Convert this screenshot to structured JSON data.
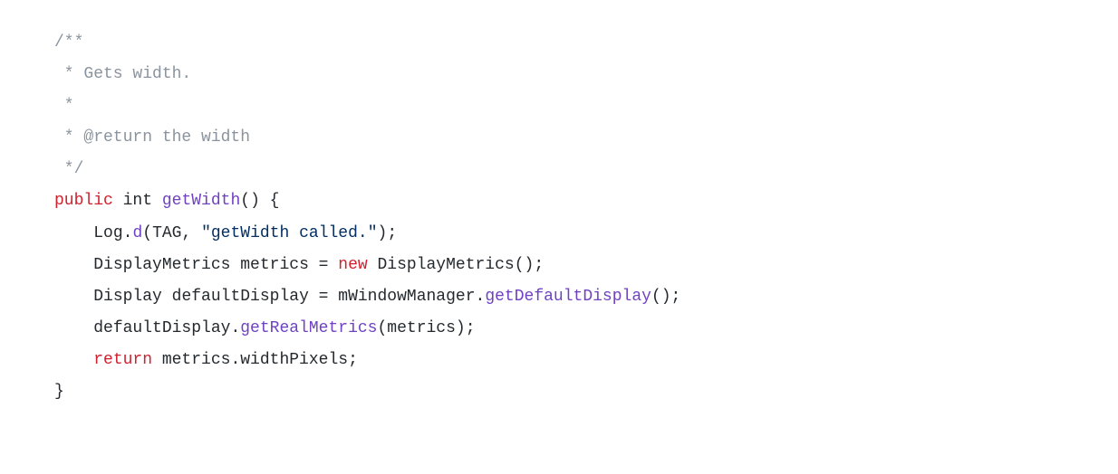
{
  "code": {
    "line1": {
      "comment_open": "/**"
    },
    "line2": {
      "comment": " * Gets width."
    },
    "line3": {
      "comment": " *"
    },
    "line4": {
      "comment": " * @return the width"
    },
    "line5": {
      "comment": " */"
    },
    "line6": {
      "keyword_public": "public",
      "type_int": "int",
      "method_name": "getWidth",
      "parens": "()",
      "brace": " {"
    },
    "line7": {
      "log_class": "Log",
      "dot1": ".",
      "log_method": "d",
      "paren_open": "(",
      "tag_const": "TAG",
      "comma": ", ",
      "string_literal": "\"getWidth called.\"",
      "paren_close": ")",
      "semi": ";"
    },
    "line8": {
      "type_dm": "DisplayMetrics",
      "var_metrics": " metrics = ",
      "keyword_new": "new",
      "ctor": " DisplayMetrics()",
      "semi": ";"
    },
    "line9": {
      "type_display": "Display",
      "var_default": " defaultDisplay = mWindowManager.",
      "method_call": "getDefaultDisplay",
      "tail": "();"
    },
    "line10": {
      "obj": "defaultDisplay.",
      "method_call": "getRealMetrics",
      "tail": "(metrics);"
    },
    "line11": {
      "keyword_return": "return",
      "expr": " metrics.widthPixels;"
    },
    "line12": {
      "brace": "}"
    }
  }
}
